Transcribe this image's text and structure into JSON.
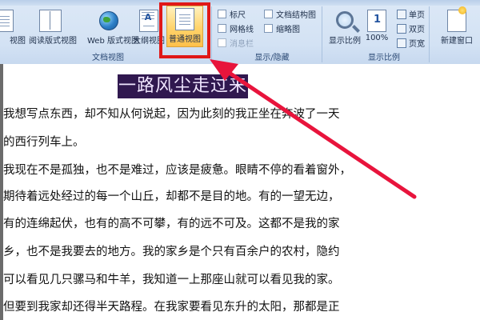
{
  "ribbon": {
    "view_buttons": [
      {
        "label": "视图"
      },
      {
        "label": "阅读版式视图"
      },
      {
        "label": "Web 版式视图"
      },
      {
        "label": "大纲视图"
      },
      {
        "label": "普通视图"
      }
    ],
    "groups": {
      "doc_views": "文档视图",
      "show_hide": "显示/隐藏",
      "zoom": "显示比例"
    },
    "checkboxes": {
      "ruler": "标尺",
      "gridlines": "网格线",
      "message_bar": "消息栏",
      "doc_map": "文档结构图",
      "thumbnails": "缩略图"
    },
    "zoom_buttons": {
      "zoom": "显示比例",
      "hundred": "100%",
      "one_page": "单页",
      "two_pages": "双页",
      "page_width": "页宽"
    },
    "window": {
      "new_window": "新建窗口"
    }
  },
  "document": {
    "title": "一路风尘走过来",
    "lines": [
      "我想写点东西，却不知从何说起，因为此刻的我正坐在奔波了一天",
      "的西行列车上。",
      "我现在不是孤独，也不是难过，应该是疲惫。眼睛不停的看着窗外，",
      "期待着远处经过的每一个山丘，却都不是目的地。有的一望无边，",
      "有的连绵起伏，也有的高不可攀，有的远不可及。这都不是我的家",
      "乡，也不是我要去的地方。我的家乡是个只有百余户的农村，隐约",
      "可以看见几只骡马和牛羊，我知道一上那座山就可以看见我的家。",
      "但要到我家却还得半天路程。在我家要看见东升的太阳，那都是正"
    ]
  },
  "colors": {
    "highlight_box": "#e01818",
    "arrow": "#e8143c",
    "title_bg": "#30184f"
  }
}
